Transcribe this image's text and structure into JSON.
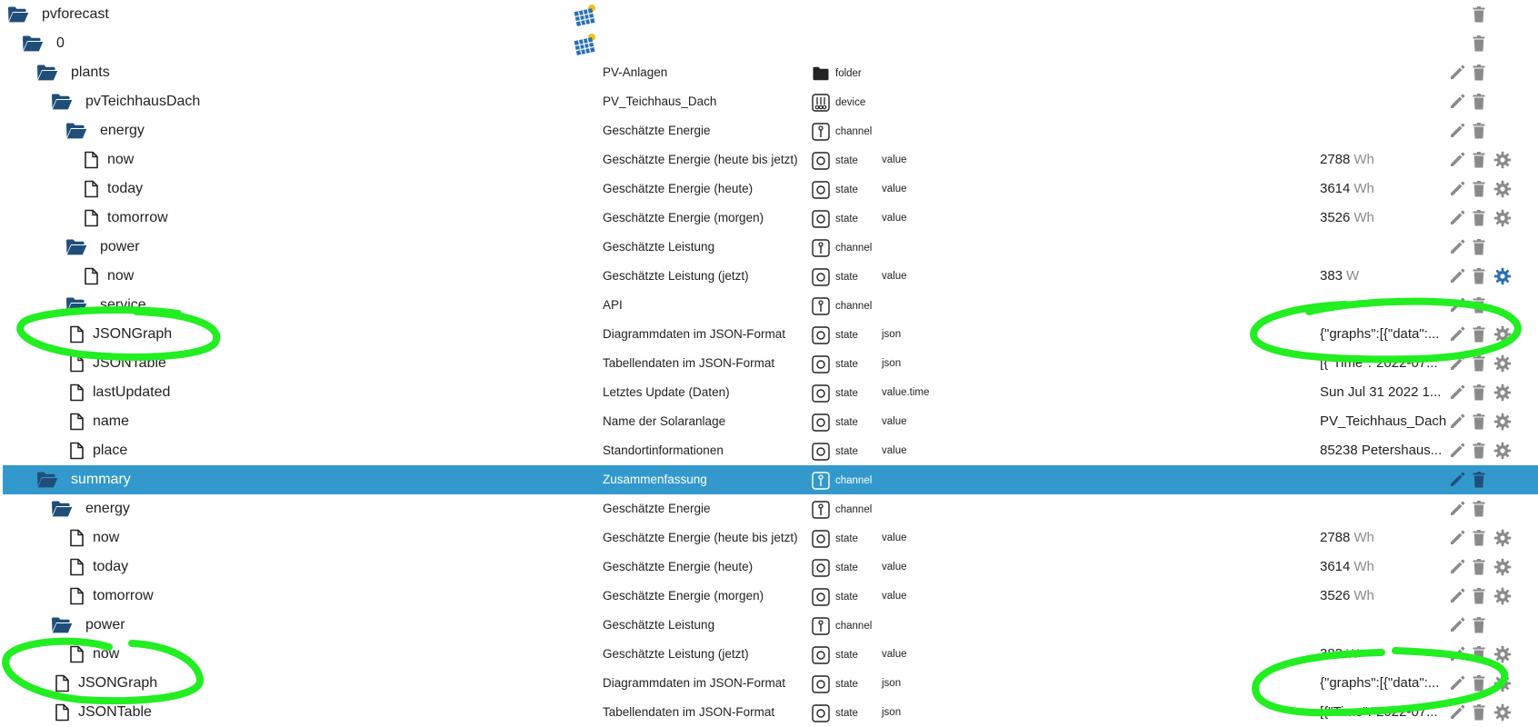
{
  "tree": [
    {
      "name": "pvforecast",
      "icon": "folder-open-icon",
      "level": 0,
      "adapter_icon": true,
      "actions": [
        "delete"
      ]
    },
    {
      "name": "0",
      "icon": "folder-open-icon",
      "level": 1,
      "adapter_icon": true,
      "actions": [
        "delete"
      ]
    },
    {
      "name": "plants",
      "icon": "folder-open-icon",
      "level": 2,
      "desc": "PV-Anlagen",
      "type": "folder",
      "type_icon": "folder-solid-icon",
      "actions": [
        "edit",
        "delete"
      ]
    },
    {
      "name": "pvTeichhausDach",
      "icon": "folder-open-icon",
      "level": 3,
      "desc": "PV_Teichhaus_Dach",
      "type": "device",
      "type_icon": "device-icon",
      "actions": [
        "edit",
        "delete"
      ]
    },
    {
      "name": "energy",
      "icon": "folder-open-icon",
      "level": 4,
      "desc": "Geschätzte Energie",
      "type": "channel",
      "type_icon": "channel-icon",
      "actions": [
        "edit",
        "delete"
      ]
    },
    {
      "name": "now",
      "icon": "file-icon",
      "level": 5,
      "desc": "Geschätzte Energie (heute bis jetzt)",
      "type": "state",
      "type_icon": "state-icon",
      "role": "value",
      "value": "2788",
      "unit": "Wh",
      "actions": [
        "edit",
        "delete",
        "settings"
      ]
    },
    {
      "name": "today",
      "icon": "file-icon",
      "level": 5,
      "desc": "Geschätzte Energie (heute)",
      "type": "state",
      "type_icon": "state-icon",
      "role": "value",
      "value": "3614",
      "unit": "Wh",
      "actions": [
        "edit",
        "delete",
        "settings"
      ]
    },
    {
      "name": "tomorrow",
      "icon": "file-icon",
      "level": 5,
      "desc": "Geschätzte Energie (morgen)",
      "type": "state",
      "type_icon": "state-icon",
      "role": "value",
      "value": "3526",
      "unit": "Wh",
      "actions": [
        "edit",
        "delete",
        "settings"
      ]
    },
    {
      "name": "power",
      "icon": "folder-open-icon",
      "level": 4,
      "desc": "Geschätzte Leistung",
      "type": "channel",
      "type_icon": "channel-icon",
      "actions": [
        "edit",
        "delete"
      ]
    },
    {
      "name": "now",
      "icon": "file-icon",
      "level": 5,
      "desc": "Geschätzte Leistung (jetzt)",
      "type": "state",
      "type_icon": "state-icon",
      "role": "value",
      "value": "383",
      "unit": "W",
      "actions": [
        "edit",
        "delete",
        "settings"
      ],
      "settings_active": true
    },
    {
      "name": "service",
      "icon": "folder-open-icon",
      "level": 4,
      "desc": "API",
      "type": "channel",
      "type_icon": "channel-icon",
      "actions": [
        "edit",
        "delete"
      ]
    },
    {
      "name": "JSONGraph",
      "icon": "file-icon",
      "level": 4,
      "desc": "Diagrammdaten im JSON-Format",
      "type": "state",
      "type_icon": "state-icon",
      "role": "json",
      "value": "{\"graphs\":[{\"data\":...",
      "actions": [
        "edit",
        "delete",
        "settings"
      ]
    },
    {
      "name": "JSONTable",
      "icon": "file-icon",
      "level": 4,
      "desc": "Tabellendaten im JSON-Format",
      "type": "state",
      "type_icon": "state-icon",
      "role": "json",
      "value": "[{\"Time\":\"2022-07...",
      "actions": [
        "edit",
        "delete",
        "settings"
      ]
    },
    {
      "name": "lastUpdated",
      "icon": "file-icon",
      "level": 4,
      "desc": "Letztes Update (Daten)",
      "type": "state",
      "type_icon": "state-icon",
      "role": "value.time",
      "value": "Sun Jul 31 2022 1...",
      "actions": [
        "edit",
        "delete",
        "settings"
      ]
    },
    {
      "name": "name",
      "icon": "file-icon",
      "level": 4,
      "desc": "Name der Solaranlage",
      "type": "state",
      "type_icon": "state-icon",
      "role": "value",
      "value": "PV_Teichhaus_Dach",
      "actions": [
        "edit",
        "delete",
        "settings"
      ]
    },
    {
      "name": "place",
      "icon": "file-icon",
      "level": 4,
      "desc": "Standortinformationen",
      "type": "state",
      "type_icon": "state-icon",
      "role": "value",
      "value": "85238 Petershaus...",
      "actions": [
        "edit",
        "delete",
        "settings"
      ]
    },
    {
      "name": "summary",
      "icon": "folder-open-icon",
      "level": 2,
      "desc": "Zusammenfassung",
      "type": "channel",
      "type_icon": "channel-icon",
      "actions": [
        "edit",
        "delete"
      ],
      "selected": true
    },
    {
      "name": "energy",
      "icon": "folder-open-icon",
      "level": 3,
      "desc": "Geschätzte Energie",
      "type": "channel",
      "type_icon": "channel-icon",
      "actions": [
        "edit",
        "delete"
      ]
    },
    {
      "name": "now",
      "icon": "file-icon",
      "level": 4,
      "desc": "Geschätzte Energie (heute bis jetzt)",
      "type": "state",
      "type_icon": "state-icon",
      "role": "value",
      "value": "2788",
      "unit": "Wh",
      "actions": [
        "edit",
        "delete",
        "settings"
      ]
    },
    {
      "name": "today",
      "icon": "file-icon",
      "level": 4,
      "desc": "Geschätzte Energie (heute)",
      "type": "state",
      "type_icon": "state-icon",
      "role": "value",
      "value": "3614",
      "unit": "Wh",
      "actions": [
        "edit",
        "delete",
        "settings"
      ]
    },
    {
      "name": "tomorrow",
      "icon": "file-icon",
      "level": 4,
      "desc": "Geschätzte Energie (morgen)",
      "type": "state",
      "type_icon": "state-icon",
      "role": "value",
      "value": "3526",
      "unit": "Wh",
      "actions": [
        "edit",
        "delete",
        "settings"
      ]
    },
    {
      "name": "power",
      "icon": "folder-open-icon",
      "level": 3,
      "desc": "Geschätzte Leistung",
      "type": "channel",
      "type_icon": "channel-icon",
      "actions": [
        "edit",
        "delete"
      ]
    },
    {
      "name": "now",
      "icon": "file-icon",
      "level": 4,
      "desc": "Geschätzte Leistung (jetzt)",
      "type": "state",
      "type_icon": "state-icon",
      "role": "value",
      "value": "383",
      "unit": "W",
      "actions": [
        "edit",
        "delete",
        "settings"
      ]
    },
    {
      "name": "JSONGraph",
      "icon": "file-icon",
      "level": 3,
      "desc": "Diagrammdaten im JSON-Format",
      "type": "state",
      "type_icon": "state-icon",
      "role": "json",
      "value": "{\"graphs\":[{\"data\":...",
      "actions": [
        "edit",
        "delete",
        "settings"
      ]
    },
    {
      "name": "JSONTable",
      "icon": "file-icon",
      "level": 3,
      "desc": "Tabellendaten im JSON-Format",
      "type": "state",
      "type_icon": "state-icon",
      "role": "json",
      "value": "[{\"Time\":\"2022-07...",
      "actions": [
        "edit",
        "delete",
        "settings"
      ]
    }
  ],
  "colors": {
    "folder": "#1f4e79",
    "selected_bg": "#3399cc",
    "action_gray": "#8a8a8a",
    "settings_active": "#2a6fb0",
    "annotation": "#22ee22"
  }
}
